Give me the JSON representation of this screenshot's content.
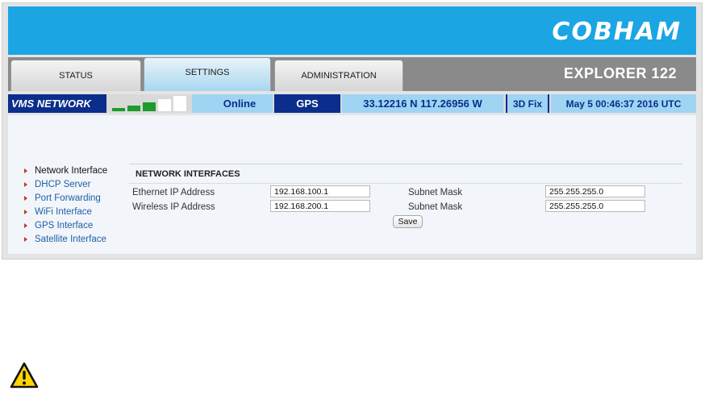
{
  "brand": {
    "logo_text": "COBHAM",
    "banner_color": "#1ba5e3"
  },
  "tabs": [
    {
      "label": "STATUS",
      "active": false
    },
    {
      "label": "SETTINGS",
      "active": true
    },
    {
      "label": "ADMINISTRATION",
      "active": false
    }
  ],
  "product_name": "EXPLORER 122",
  "status": {
    "network_label": "VMS NETWORK",
    "signal_bars": {
      "filled": 3,
      "total": 5,
      "filled_color": "#1e9b2a",
      "empty_color": "#ffffff"
    },
    "network_state": "Online",
    "gps_label": "GPS",
    "coordinates": "33.12216 N 117.26956 W",
    "fix": "3D Fix",
    "datetime": "May 5 00:46:37 2016 UTC",
    "colors": {
      "dark": "#0b2d8c",
      "light": "#9fd4f2"
    }
  },
  "nav": [
    {
      "label": "Network Interface",
      "current": true
    },
    {
      "label": "DHCP Server",
      "current": false
    },
    {
      "label": "Port Forwarding",
      "current": false
    },
    {
      "label": "WiFi Interface",
      "current": false
    },
    {
      "label": "GPS Interface",
      "current": false
    },
    {
      "label": "Satellite Interface",
      "current": false
    }
  ],
  "form": {
    "section_title": "NETWORK INTERFACES",
    "rows": [
      {
        "label": "Ethernet IP Address",
        "ip": "192.168.100.1",
        "mask_label": "Subnet Mask",
        "mask": "255.255.255.0"
      },
      {
        "label": "Wireless IP Address",
        "ip": "192.168.200.1",
        "mask_label": "Subnet Mask",
        "mask": "255.255.255.0"
      }
    ],
    "save_label": "Save"
  },
  "warning_icon": "warning-triangle-icon"
}
